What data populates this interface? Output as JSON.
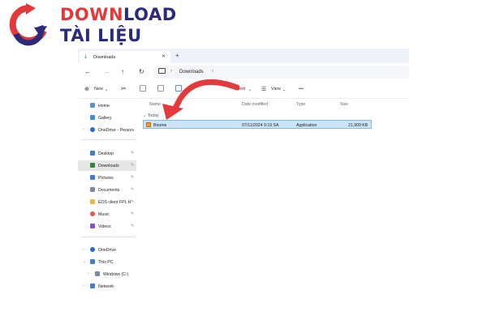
{
  "logo": {
    "line1_part1": "DOWN",
    "line1_part2": "LOAD",
    "line2": "TÀI LIỆU"
  },
  "window": {
    "tab_title": "Downloads",
    "tab_close": "✕",
    "tab_add": "+",
    "address": "Downloads"
  },
  "nav": {
    "back": "←",
    "forward": "→",
    "up": "↑",
    "refresh": "↻"
  },
  "toolbar": {
    "new_label": "New",
    "sort_label": "Sort",
    "view_label": "View",
    "more_label": "•••"
  },
  "sidebar": {
    "items": [
      {
        "label": "Home",
        "icon": "home-icon",
        "color": "#5a8fd6"
      },
      {
        "label": "Gallery",
        "icon": "gallery-icon",
        "color": "#3a8fd9"
      },
      {
        "label": "OneDrive - Persona",
        "icon": "onedrive-icon",
        "color": "#1f6fd1"
      },
      {
        "label": "Desktop",
        "icon": "desktop-icon",
        "color": "#3f7fd0"
      },
      {
        "label": "Downloads",
        "icon": "download-icon",
        "color": "#2e8a3b"
      },
      {
        "label": "Pictures",
        "icon": "pictures-icon",
        "color": "#3f7fd0"
      },
      {
        "label": "Documents",
        "icon": "documents-icon",
        "color": "#7a8ca0"
      },
      {
        "label": "EOS client FPL H",
        "icon": "folder-icon",
        "color": "#e9b93f"
      },
      {
        "label": "Music",
        "icon": "music-icon",
        "color": "#e2574c"
      },
      {
        "label": "Videos",
        "icon": "videos-icon",
        "color": "#8a4fd1"
      },
      {
        "label": "OneDrive",
        "icon": "onedrive-icon",
        "color": "#1f6fd1"
      },
      {
        "label": "This PC",
        "icon": "pc-icon",
        "color": "#3f7fd0"
      },
      {
        "label": "Windows (C:)",
        "icon": "drive-icon",
        "color": "#7a8ca0"
      },
      {
        "label": "Network",
        "icon": "network-icon",
        "color": "#3f7fd0"
      }
    ]
  },
  "columns": {
    "name": "Name",
    "date": "Date modified",
    "type": "Type",
    "size": "Size"
  },
  "group_label": "Today",
  "files": [
    {
      "name": "Bnome",
      "date": "07/11/2024 9:19 SA",
      "type": "Application",
      "size": "21,909 KB"
    }
  ],
  "colors": {
    "logo_red": "#e23a3a",
    "logo_navy": "#2b2b7c",
    "arrow_red": "#e5393b",
    "selection": "#cce4f7"
  }
}
